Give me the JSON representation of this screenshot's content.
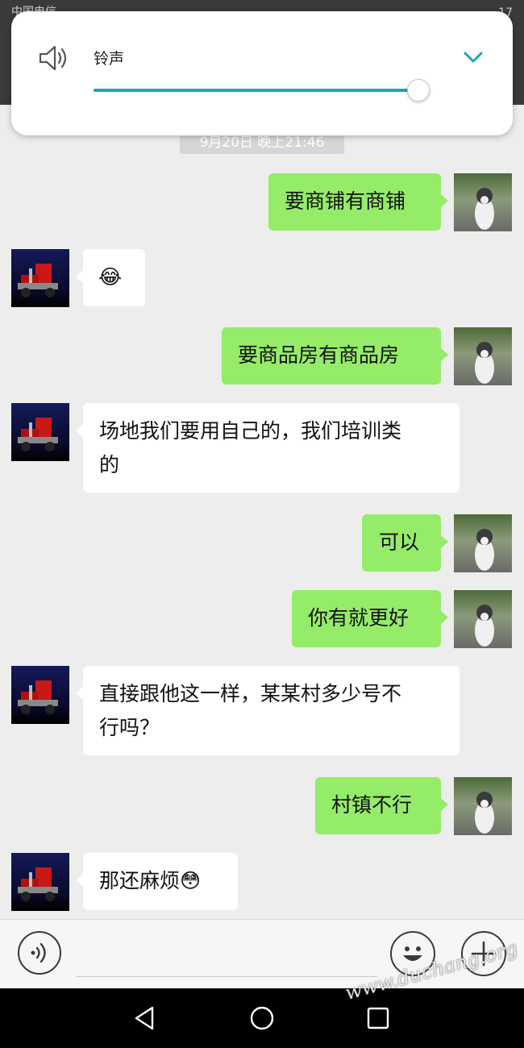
{
  "status_bar": {
    "carrier": "中国电信",
    "clock": "17"
  },
  "volume": {
    "label": "铃声",
    "level": 0.97,
    "accent_color": "#1aa5b5"
  },
  "chat": {
    "timestamp": "9月20日 晚上21:46",
    "messages": [
      {
        "side": "right",
        "text": "要商铺有商铺"
      },
      {
        "side": "left",
        "text": "😂"
      },
      {
        "side": "right",
        "text": "要商品房有商品房"
      },
      {
        "side": "left",
        "line1": "场地我们要用自己的，我们培训类",
        "line2": "的"
      },
      {
        "side": "right",
        "text": "可以"
      },
      {
        "side": "right",
        "text": "你有就更好"
      },
      {
        "side": "left",
        "line1": "直接跟他这一样，某某村多少号不",
        "line2": "行吗？"
      },
      {
        "side": "right",
        "text": "村镇不行"
      },
      {
        "side": "left",
        "text": "那还麻烦😳"
      }
    ]
  },
  "input_bar": {
    "voice_icon": "voice-icon",
    "emoji_icon": "emoji-icon",
    "plus_icon": "plus-icon"
  },
  "navbar": {
    "back_icon": "back-icon",
    "home_icon": "home-icon",
    "recent_icon": "recent-icon"
  },
  "watermark": "www.duchang.org",
  "colors": {
    "green_bubble": "#95ec69",
    "white_bubble": "#ffffff",
    "background": "#ededed"
  }
}
